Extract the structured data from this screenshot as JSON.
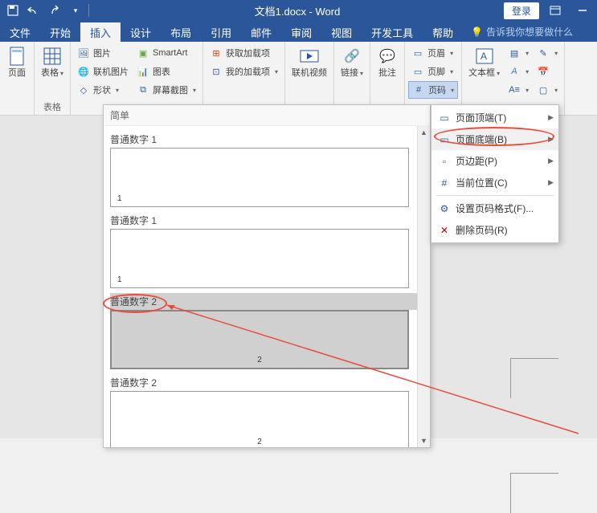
{
  "title_bar": {
    "doc_title": "文档1.docx - Word",
    "login": "登录"
  },
  "tabs": {
    "file": "文件",
    "home": "开始",
    "insert": "插入",
    "design": "设计",
    "layout": "布局",
    "references": "引用",
    "mailings": "邮件",
    "review": "审阅",
    "view": "视图",
    "developer": "开发工具",
    "help": "帮助",
    "tell_me": "告诉我你想要做什么"
  },
  "ribbon": {
    "pages": {
      "cover": "页面"
    },
    "tables": {
      "label": "表格",
      "btn": "表格"
    },
    "illustrations": {
      "pictures": "图片",
      "online_pictures": "联机图片",
      "shapes": "形状",
      "smartart": "SmartArt",
      "chart": "图表",
      "screenshot": "屏幕截图"
    },
    "addins": {
      "get": "获取加载项",
      "my": "我的加载项"
    },
    "media": {
      "online_video": "联机视频"
    },
    "links": {
      "label": "链接"
    },
    "comments": {
      "label": "批注"
    },
    "header_footer": {
      "header": "页眉",
      "footer": "页脚",
      "page_number": "页码"
    },
    "text": {
      "text_box": "文本框"
    }
  },
  "gallery": {
    "header": "简单",
    "items": [
      {
        "label": "普通数字 1",
        "num": "1",
        "pos": "left"
      },
      {
        "label": "普通数字 1",
        "num": "1",
        "pos": "left"
      },
      {
        "label": "普通数字 2",
        "num": "2",
        "pos": "center",
        "selected": true
      },
      {
        "label": "普通数字 2",
        "num": "2",
        "pos": "center"
      }
    ]
  },
  "context_menu": {
    "top": "页面顶端(T)",
    "bottom": "页面底端(B)",
    "margins": "页边距(P)",
    "current": "当前位置(C)",
    "format": "设置页码格式(F)...",
    "remove": "删除页码(R)"
  }
}
